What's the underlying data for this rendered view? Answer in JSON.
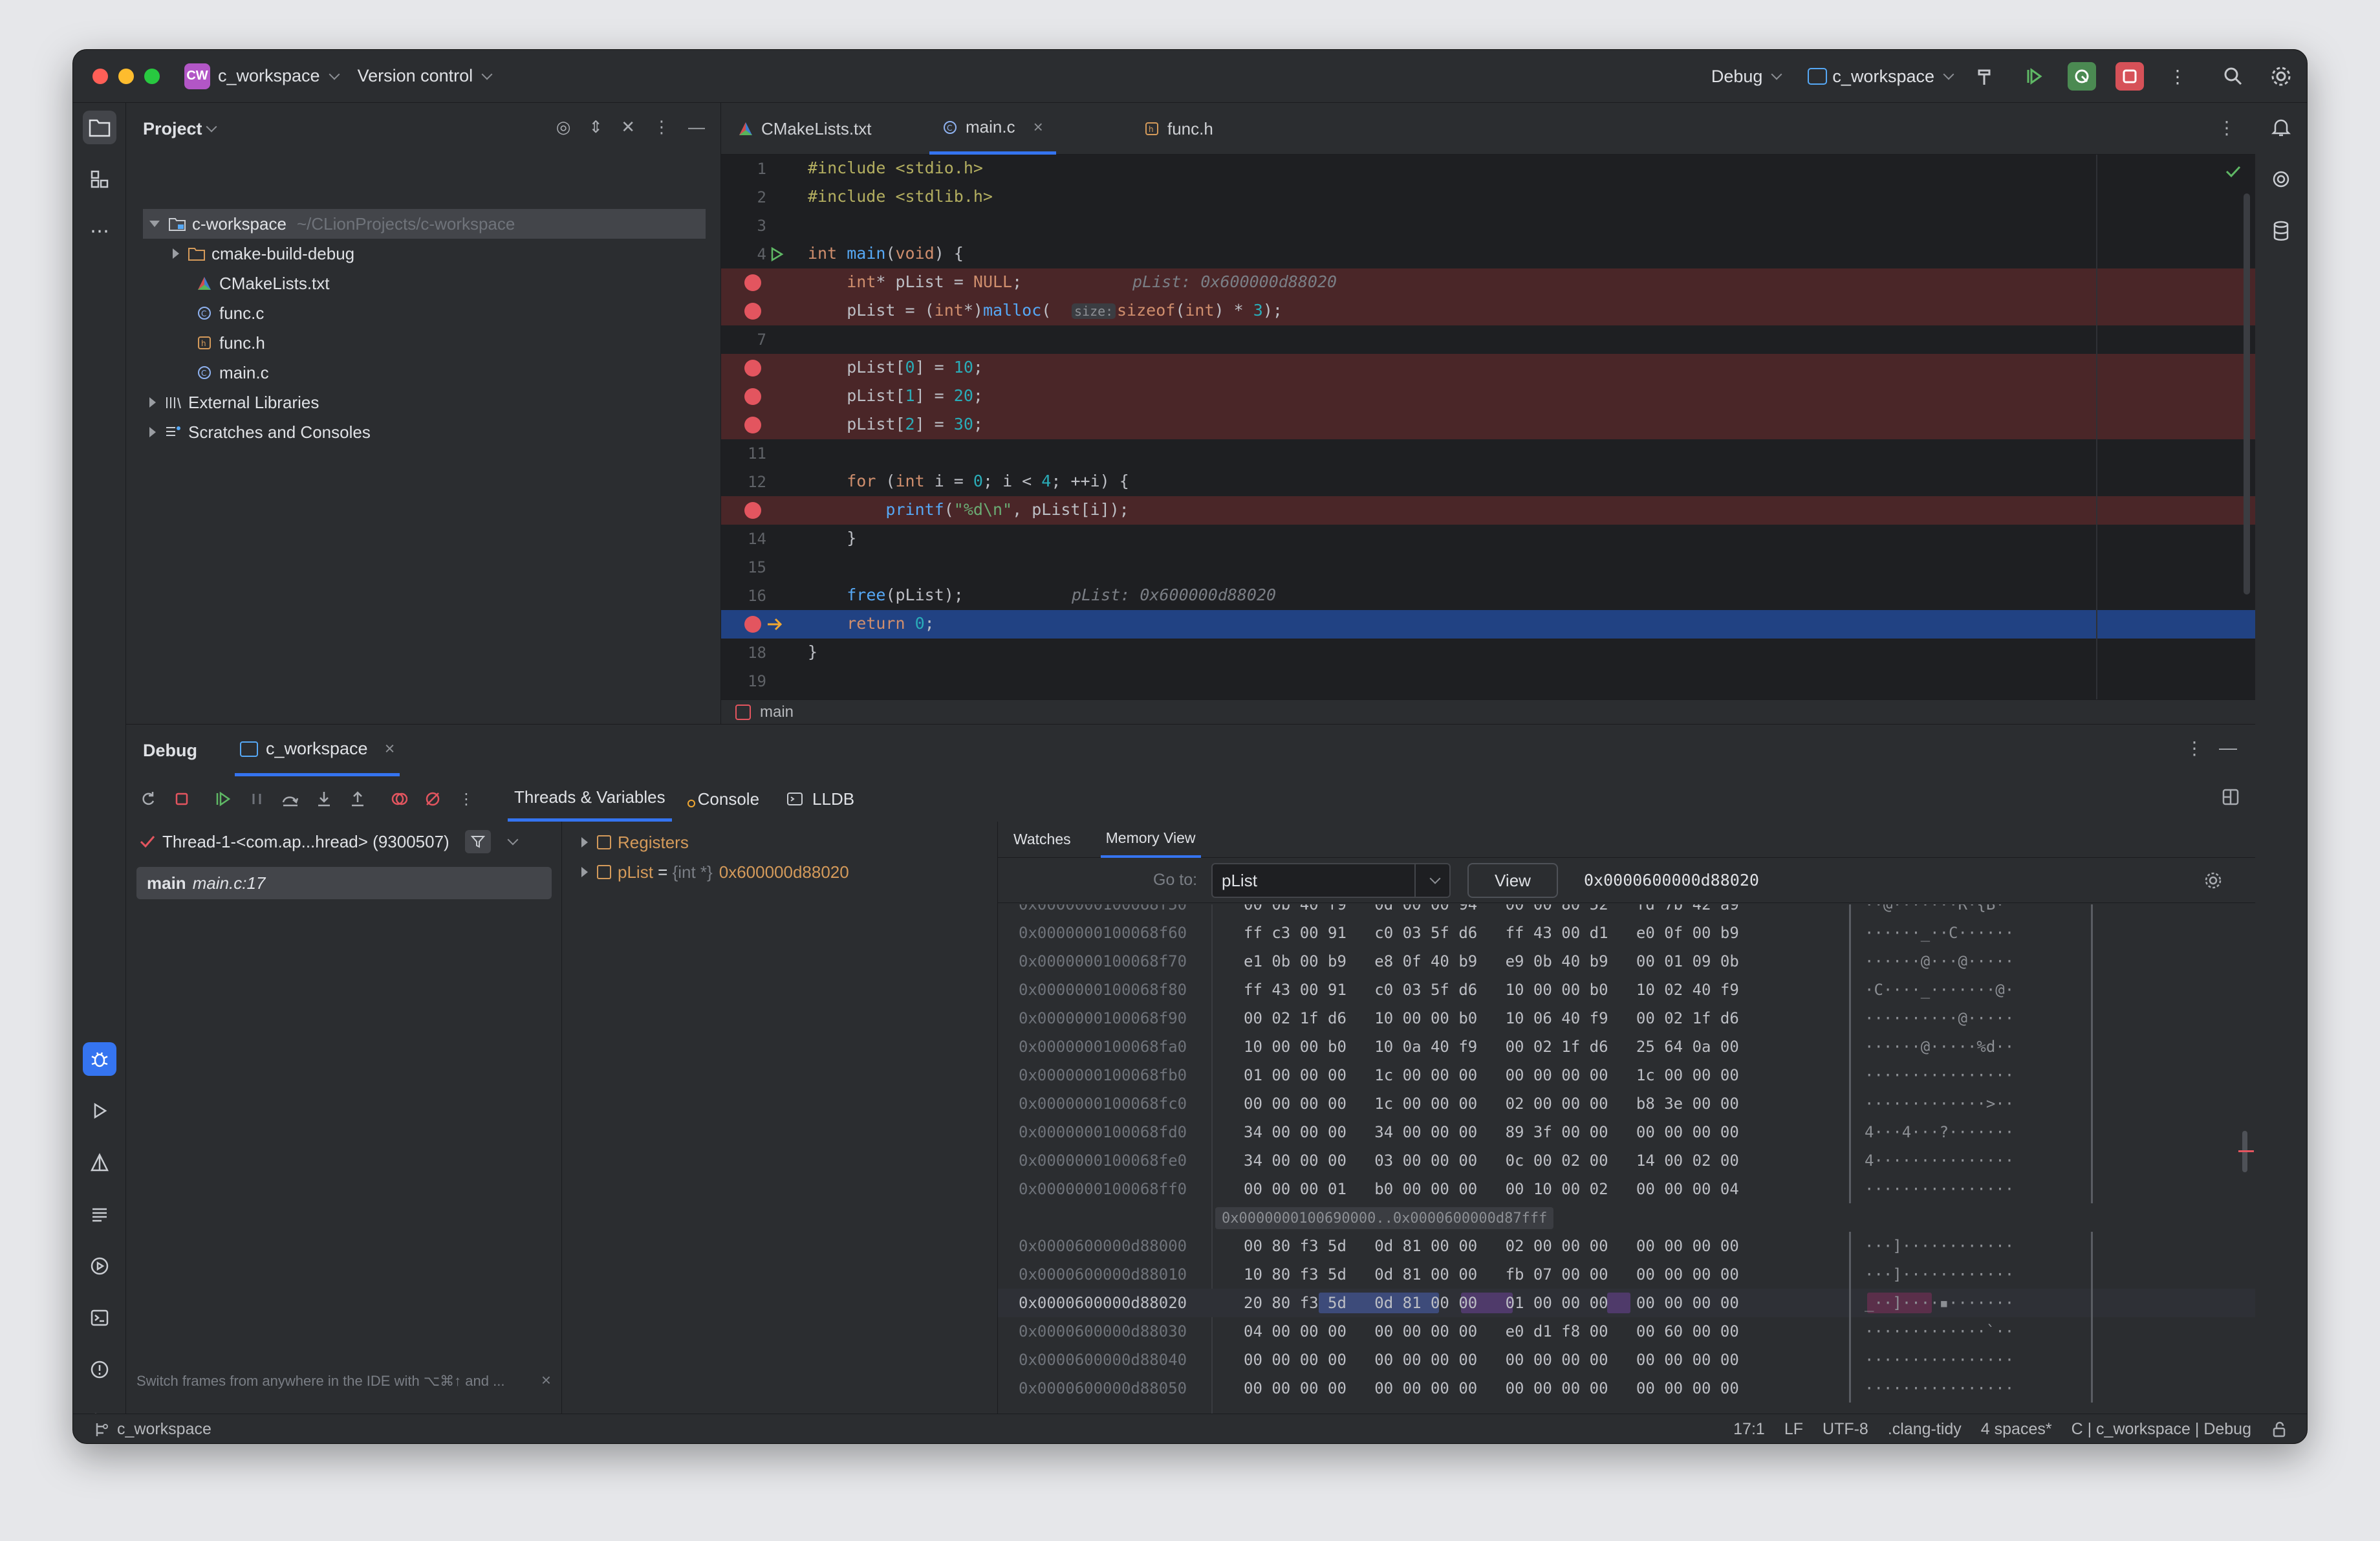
{
  "titlebar": {
    "project_badge": "CW",
    "project_name": "c_workspace",
    "vcs": "Version control",
    "run_config": "Debug",
    "target": "c_workspace"
  },
  "project_panel": {
    "title": "Project",
    "items": [
      {
        "label": "c-workspace",
        "path": "~/CLionProjects/c-workspace"
      },
      {
        "label": "cmake-build-debug"
      },
      {
        "label": "CMakeLists.txt"
      },
      {
        "label": "func.c"
      },
      {
        "label": "func.h"
      },
      {
        "label": "main.c"
      },
      {
        "label": "External Libraries"
      },
      {
        "label": "Scratches and Consoles"
      }
    ]
  },
  "editor": {
    "tabs": [
      {
        "label": "CMakeLists.txt"
      },
      {
        "label": "main.c"
      },
      {
        "label": "func.h"
      }
    ],
    "lines": [
      {
        "n": "1",
        "code": "#include <stdio.h>"
      },
      {
        "n": "2",
        "code": "#include <stdlib.h>"
      },
      {
        "n": "3",
        "code": ""
      },
      {
        "n": "4",
        "code": "int main(void) {"
      },
      {
        "n": "5",
        "code": "    int* pList = NULL;",
        "hint": "pList: 0x600000d88020"
      },
      {
        "n": "6",
        "code": "    pList = (int*)malloc(",
        "inlay": "size:",
        "code2": "sizeof(int) * 3);"
      },
      {
        "n": "7",
        "code": ""
      },
      {
        "n": "8",
        "code": "    pList[0] = 10;"
      },
      {
        "n": "9",
        "code": "    pList[1] = 20;"
      },
      {
        "n": "10",
        "code": "    pList[2] = 30;"
      },
      {
        "n": "11",
        "code": ""
      },
      {
        "n": "12",
        "code": "    for (int i = 0; i < 4; ++i) {"
      },
      {
        "n": "13",
        "code": "        printf(\"%d\\n\", pList[i]);"
      },
      {
        "n": "14",
        "code": "    }"
      },
      {
        "n": "15",
        "code": ""
      },
      {
        "n": "16",
        "code": "    free(pList);",
        "hint": "pList: 0x600000d88020"
      },
      {
        "n": "17",
        "code": "    return 0;"
      },
      {
        "n": "18",
        "code": "}"
      },
      {
        "n": "19",
        "code": ""
      }
    ],
    "breadcrumb": "main"
  },
  "debug": {
    "title": "Debug",
    "session": "c_workspace",
    "tabs": {
      "threads": "Threads & Variables",
      "console": "Console",
      "lldb": "LLDB"
    },
    "thread": "Thread-1-<com.ap...hread> (9300507)",
    "frame_fn": "main",
    "frame_loc": "main.c:17",
    "tip": "Switch frames from anywhere in the IDE with ⌥⌘↑ and ...",
    "vars": {
      "registers": "Registers",
      "plist_name": "pList",
      "plist_eq": " = ",
      "plist_type": "{int *}",
      "plist_value": "0x600000d88020"
    },
    "memory": {
      "tabs": {
        "watches": "Watches",
        "memory_view": "Memory View"
      },
      "goto_label": "Go to:",
      "goto_value": "pList",
      "view_button": "View",
      "address": "0x0000600000d88020",
      "gap_label": "0x0000000100690000..0x0000600000d87fff",
      "rows_top": [
        {
          "addr": "0x0000000100068f60",
          "bytes": "ff c3 00 91   c0 03 5f d6   ff 43 00 d1   e0 0f 00 b9",
          "ascii": "······_··C······"
        },
        {
          "addr": "0x0000000100068f70",
          "bytes": "e1 0b 00 b9   e8 0f 40 b9   e9 0b 40 b9   00 01 09 0b",
          "ascii": "······@···@·····"
        },
        {
          "addr": "0x0000000100068f80",
          "bytes": "ff 43 00 91   c0 03 5f d6   10 00 00 b0   10 02 40 f9",
          "ascii": "·C····_·······@·"
        },
        {
          "addr": "0x0000000100068f90",
          "bytes": "00 02 1f d6   10 00 00 b0   10 06 40 f9   00 02 1f d6",
          "ascii": "··········@·····"
        },
        {
          "addr": "0x0000000100068fa0",
          "bytes": "10 00 00 b0   10 0a 40 f9   00 02 1f d6   25 64 0a 00",
          "ascii": "······@·····%d··"
        },
        {
          "addr": "0x0000000100068fb0",
          "bytes": "01 00 00 00   1c 00 00 00   00 00 00 00   1c 00 00 00",
          "ascii": "················"
        },
        {
          "addr": "0x0000000100068fc0",
          "bytes": "00 00 00 00   1c 00 00 00   02 00 00 00   b8 3e 00 00",
          "ascii": "·············>··"
        },
        {
          "addr": "0x0000000100068fd0",
          "bytes": "34 00 00 00   34 00 00 00   89 3f 00 00   00 00 00 00",
          "ascii": "4···4···?·······"
        },
        {
          "addr": "0x0000000100068fe0",
          "bytes": "34 00 00 00   03 00 00 00   0c 00 02 00   14 00 02 00",
          "ascii": "4···············"
        },
        {
          "addr": "0x0000000100068ff0",
          "bytes": "00 00 00 01   b0 00 00 00   00 10 00 02   00 00 00 04",
          "ascii": "················"
        }
      ],
      "rows_bottom": [
        {
          "addr": "0x0000600000d88000",
          "bytes": "00 80 f3 5d   0d 81 00 00   02 00 00 00   00 00 00 00",
          "ascii": "···]············"
        },
        {
          "addr": "0x0000600000d88010",
          "bytes": "10 80 f3 5d   0d 81 00 00   fb 07 00 00   00 00 00 00",
          "ascii": "···]············"
        },
        {
          "addr": "0x0000600000d88020",
          "bytes": "20 80 f3 5d   0d 81 00 00   01 00 00 00   00 00 00 00",
          "ascii": "_··]····▪·······"
        },
        {
          "addr": "0x0000600000d88030",
          "bytes": "04 00 00 00   00 00 00 00   e0 d1 f8 00   00 60 00 00",
          "ascii": "·············`··"
        },
        {
          "addr": "0x0000600000d88040",
          "bytes": "00 00 00 00   00 00 00 00   00 00 00 00   00 00 00 00",
          "ascii": "················"
        },
        {
          "addr": "0x0000600000d88050",
          "bytes": "00 00 00 00   00 00 00 00   00 00 00 00   00 00 00 00",
          "ascii": "················"
        }
      ]
    }
  },
  "statusbar": {
    "project": "c_workspace",
    "position": "17:1",
    "line_sep": "LF",
    "encoding": "UTF-8",
    "linter": ".clang-tidy",
    "indent": "4 spaces*",
    "context": "C | c_workspace | Debug"
  },
  "colors": {
    "accent": "#3574f0",
    "breakpoint": "#e3555f",
    "current_line": "#214283"
  }
}
